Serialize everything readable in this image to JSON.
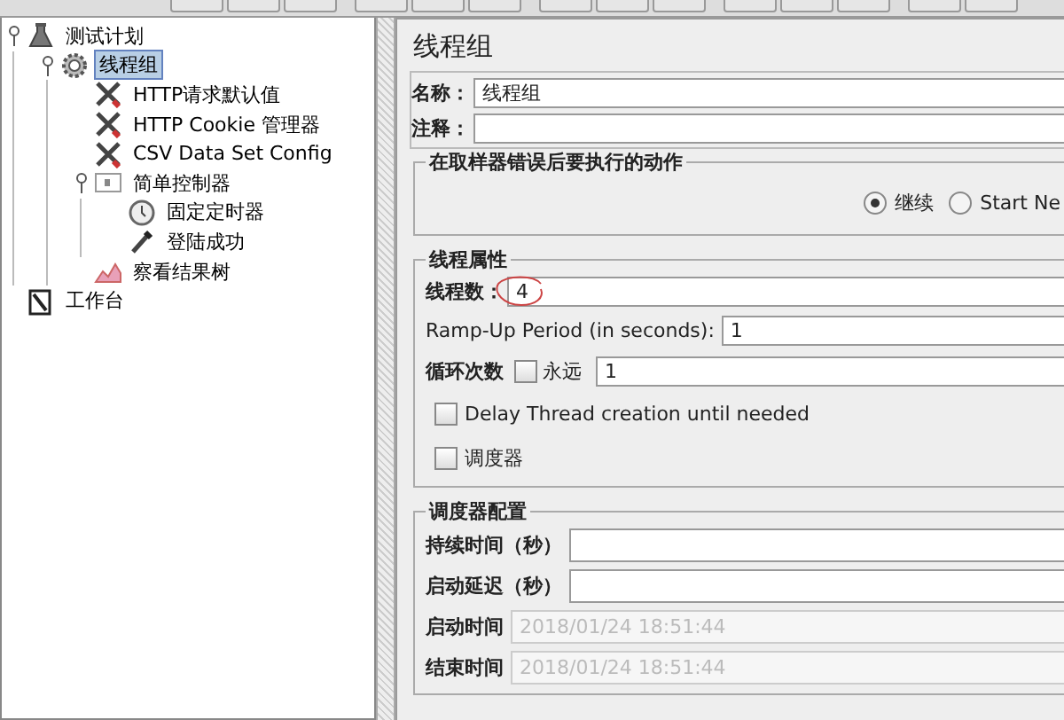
{
  "tree": [
    {
      "label": "测试计划",
      "kind": "plan",
      "expanded": true,
      "selected": false,
      "children": [
        {
          "label": "线程组",
          "kind": "threadgroup",
          "expanded": true,
          "selected": true,
          "children": [
            {
              "label": "HTTP请求默认值",
              "kind": "config",
              "selected": false
            },
            {
              "label": "HTTP Cookie 管理器",
              "kind": "config",
              "selected": false
            },
            {
              "label": "CSV Data Set Config",
              "kind": "config",
              "selected": false
            },
            {
              "label": "简单控制器",
              "kind": "controller",
              "expanded": true,
              "selected": false,
              "children": [
                {
                  "label": "固定定时器",
                  "kind": "timer",
                  "selected": false
                },
                {
                  "label": "登陆成功",
                  "kind": "sampler",
                  "selected": false
                }
              ]
            },
            {
              "label": "察看结果树",
              "kind": "listener",
              "selected": false
            }
          ]
        }
      ]
    },
    {
      "label": "工作台",
      "kind": "workbench",
      "selected": false
    }
  ],
  "form": {
    "title": "线程组",
    "name_field": {
      "label": "名称：",
      "value": "线程组"
    },
    "comment_field": {
      "label": "注释："
    },
    "error_action": {
      "title": "在取样器错误后要执行的动作",
      "options": [
        {
          "label": "继续",
          "selected": true
        },
        {
          "label": "Start Ne",
          "selected": false
        }
      ]
    },
    "thread_props": {
      "title": "线程属性",
      "thread_count": {
        "label": "线程数：",
        "value": "4"
      },
      "ramp_up": {
        "label": "Ramp-Up Period (in seconds):",
        "value": "1"
      },
      "loop": {
        "label": "循环次数",
        "forever": {
          "label": "永远",
          "checked": false
        },
        "value": "1"
      },
      "delay": {
        "label": "Delay Thread creation until needed",
        "checked": false
      },
      "scheduler": {
        "label": "调度器",
        "checked": false
      }
    },
    "scheduler_config": {
      "title": "调度器配置",
      "fields": [
        {
          "label": "持续时间（秒）",
          "disabled": false
        },
        {
          "label": "启动延迟（秒）",
          "disabled": false
        },
        {
          "label": "启动时间",
          "value": "2018/01/24 18:51:44",
          "disabled": true
        },
        {
          "label": "结束时间",
          "value": "2018/01/24 18:51:44",
          "disabled": true
        }
      ]
    }
  }
}
